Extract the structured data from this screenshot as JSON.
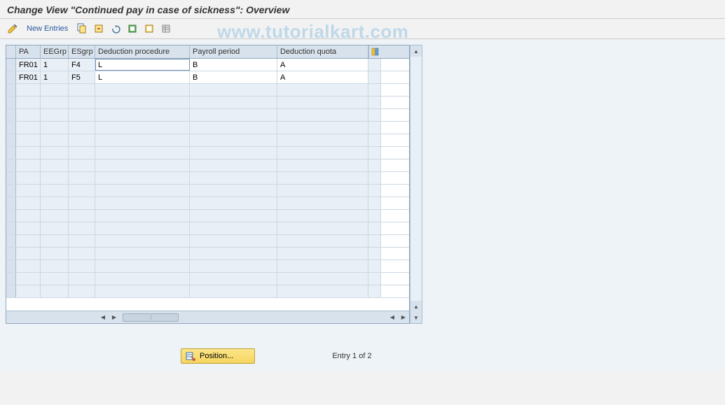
{
  "title": "Change View \"Continued pay in case of sickness\": Overview",
  "toolbar": {
    "new_entries": "New Entries"
  },
  "watermark": "www.tutorialkart.com",
  "grid": {
    "headers": {
      "pa": "PA",
      "eegrp": "EEGrp",
      "esgrp": "ESgrp",
      "deduct": "Deduction procedure",
      "payroll": "Payroll period",
      "quota": "Deduction quota"
    },
    "rows": [
      {
        "pa": "FR01",
        "eegrp": "1",
        "esgrp": "F4",
        "deduct": "L",
        "payroll": "B",
        "quota": "A"
      },
      {
        "pa": "FR01",
        "eegrp": "1",
        "esgrp": "F5",
        "deduct": "L",
        "payroll": "B",
        "quota": "A"
      }
    ]
  },
  "footer": {
    "position_label": "Position...",
    "entry_label": "Entry 1 of 2"
  }
}
